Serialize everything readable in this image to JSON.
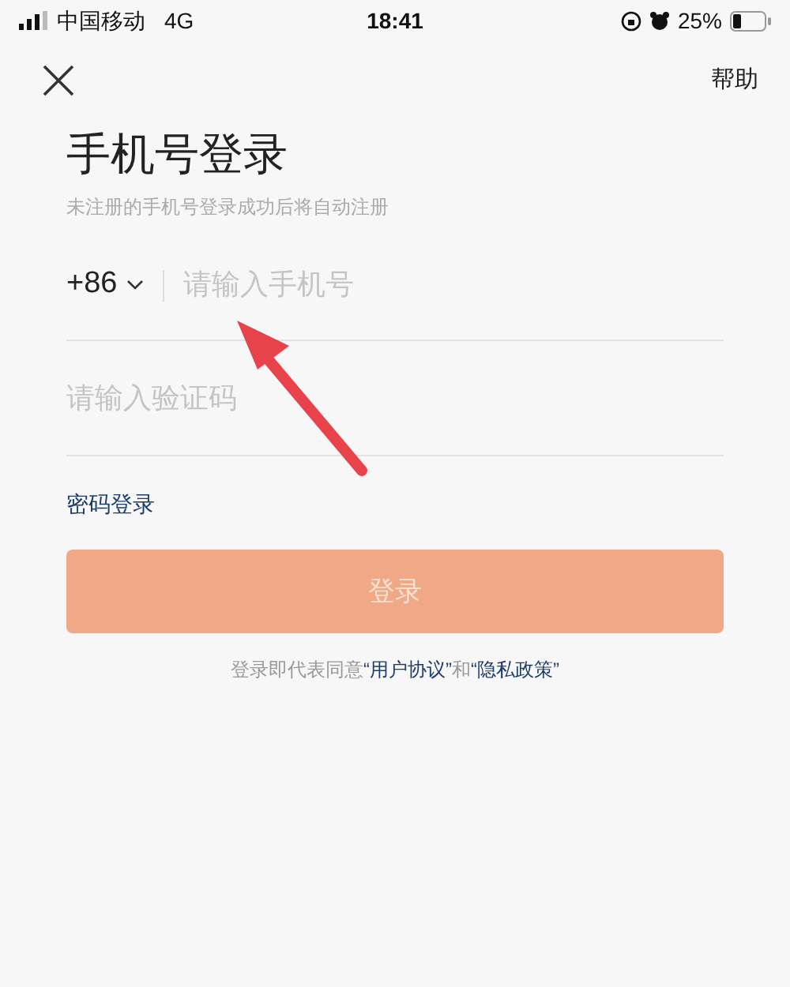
{
  "status_bar": {
    "carrier": "中国移动",
    "network": "4G",
    "time": "18:41",
    "battery": "25%"
  },
  "nav": {
    "help": "帮助"
  },
  "title": "手机号登录",
  "subtitle": "未注册的手机号登录成功后将自动注册",
  "phone": {
    "country_code": "+86",
    "placeholder": "请输入手机号"
  },
  "code": {
    "placeholder": "请输入验证码"
  },
  "password_login": "密码登录",
  "login_button": {
    "label": "登录",
    "disabled": true
  },
  "agreement": {
    "text_before": "登录即代表同意",
    "terms_link": "“用户协议”",
    "conjunction": "和",
    "privacy_link": "“隐私政策”"
  }
}
